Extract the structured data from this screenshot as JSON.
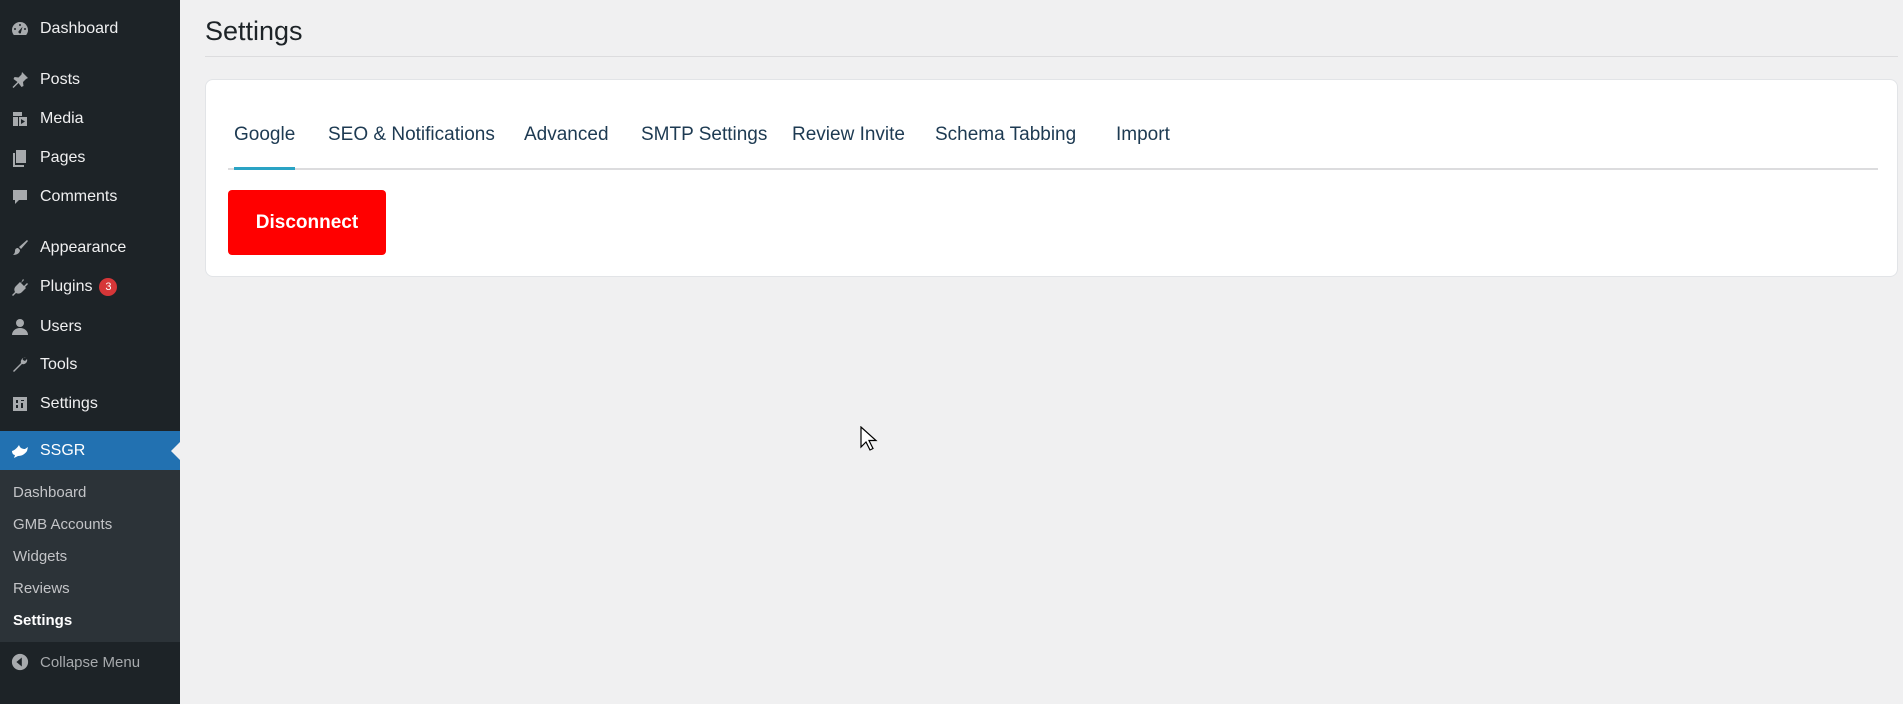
{
  "sidebar": {
    "items": [
      {
        "label": "Dashboard",
        "icon": "dashboard-icon"
      },
      {
        "label": "Posts",
        "icon": "pin-icon"
      },
      {
        "label": "Media",
        "icon": "media-icon"
      },
      {
        "label": "Pages",
        "icon": "pages-icon"
      },
      {
        "label": "Comments",
        "icon": "comment-icon"
      },
      {
        "label": "Appearance",
        "icon": "brush-icon"
      },
      {
        "label": "Plugins",
        "icon": "plugin-icon",
        "badge": "3"
      },
      {
        "label": "Users",
        "icon": "user-icon"
      },
      {
        "label": "Tools",
        "icon": "wrench-icon"
      },
      {
        "label": "Settings",
        "icon": "settings-icon"
      }
    ],
    "active": {
      "label": "SSGR",
      "icon": "ssgr-icon"
    },
    "submenu": [
      "Dashboard",
      "GMB Accounts",
      "Widgets",
      "Reviews",
      "Settings"
    ],
    "submenu_current": "Settings",
    "collapse_label": "Collapse Menu"
  },
  "main": {
    "title": "Settings",
    "tabs": [
      {
        "label": "Google",
        "active": true
      },
      {
        "label": "SEO & Notifications"
      },
      {
        "label": "Advanced"
      },
      {
        "label": "SMTP Settings"
      },
      {
        "label": "Review Invite"
      },
      {
        "label": "Schema Tabbing"
      },
      {
        "label": "Import"
      }
    ],
    "disconnect_label": "Disconnect"
  },
  "colors": {
    "sidebar_bg": "#1d2327",
    "sidebar_active": "#2271b1",
    "tab_underline": "#2aa3c4",
    "disconnect_bg": "#ff0000",
    "badge": "#d63638"
  }
}
